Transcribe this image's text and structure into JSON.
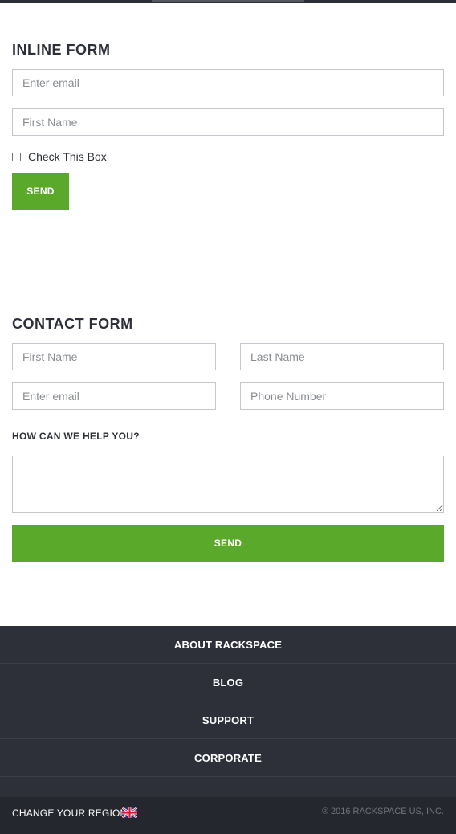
{
  "inline_form": {
    "title": "INLINE FORM",
    "email_placeholder": "Enter email",
    "first_name_placeholder": "First Name",
    "checkbox_label": "Check This Box",
    "send_label": "SEND"
  },
  "contact_form": {
    "title": "CONTACT FORM",
    "first_name_placeholder": "First Name",
    "last_name_placeholder": "Last Name",
    "email_placeholder": "Enter email",
    "phone_placeholder": "Phone Number",
    "help_label": "HOW CAN WE HELP YOU?",
    "send_label": "SEND"
  },
  "footer": {
    "nav_items": [
      "ABOUT RACKSPACE",
      "BLOG",
      "SUPPORT",
      "CORPORATE"
    ],
    "region_label": "CHANGE YOUR REGION:",
    "region_flag_icon": "uk-flag-icon",
    "copyright": "® 2016 RACKSPACE US, INC."
  },
  "colors": {
    "accent_green": "#5aa92a",
    "footer_dark": "#2d3039",
    "footer_darker": "#25272e"
  }
}
